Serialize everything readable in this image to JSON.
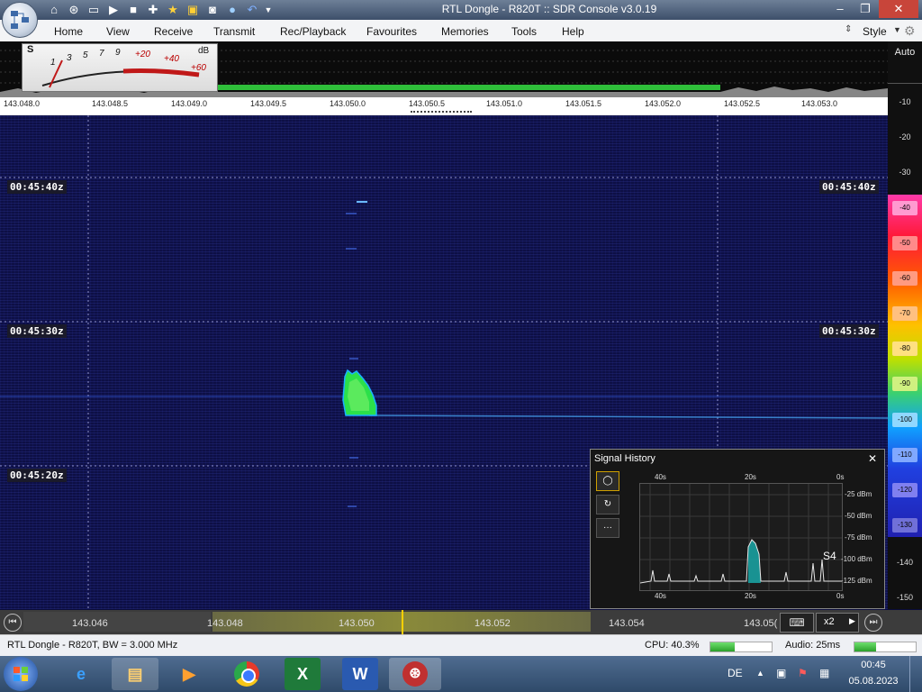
{
  "window": {
    "title": "RTL Dongle - R820T :: SDR Console v3.0.19"
  },
  "menu": {
    "items": [
      "Home",
      "View",
      "Receive",
      "Transmit",
      "Rec/Playback",
      "Favourites",
      "Memories",
      "Tools",
      "Help"
    ],
    "style_label": "Style"
  },
  "meter": {
    "s_label": "S",
    "db_label": "dB",
    "scale": [
      "1",
      "3",
      "5",
      "7",
      "9",
      "+20",
      "+40",
      "+60"
    ]
  },
  "spectrum": {
    "freq_labels": [
      "143.048.0",
      "143.048.5",
      "143.049.0",
      "143.049.5",
      "143.050.0",
      "143.050.5",
      "143.051.0",
      "143.051.5",
      "143.052.0",
      "143.052.5",
      "143.053.0"
    ]
  },
  "scale": {
    "auto_label": "Auto",
    "db_values": [
      "-10",
      "-20",
      "-30",
      "-40",
      "-50",
      "-60",
      "-70",
      "-80",
      "-90",
      "-100",
      "-110",
      "-120",
      "-130",
      "-140",
      "-150"
    ],
    "colors": [
      "#ff3aa8",
      "#ff2a2a",
      "#ff3010",
      "#ff6a00",
      "#ffb000",
      "#d6e000",
      "#7be000",
      "#22d3a0",
      "#1090ff",
      "#2050e0",
      "#2a2ad0"
    ]
  },
  "waterfall": {
    "timestamps": [
      "00:45:40z",
      "00:45:30z",
      "00:45:20z"
    ]
  },
  "signal_history": {
    "title": "Signal History",
    "close": "✕",
    "top_ticks": [
      "40s",
      "20s",
      "0s"
    ],
    "bottom_ticks": [
      "40s",
      "20s",
      "0s"
    ],
    "db_ticks": [
      "-25 dBm",
      "-50 dBm",
      "-75 dBm",
      "-100 dBm",
      "-125 dBm"
    ],
    "s_label": "S4"
  },
  "bottom_bar": {
    "freq_labels": [
      "143.046",
      "143.048",
      "143.050",
      "143.052",
      "143.054",
      "143.05("
    ],
    "zoom": "x2"
  },
  "status": {
    "device": "RTL Dongle - R820T, BW = 3.000 MHz",
    "cpu": "CPU: 40.3%",
    "cpu_level": 0.4,
    "audio": "Audio: 25ms",
    "audio_level": 0.35
  },
  "taskbar": {
    "language": "DE",
    "time": "00:45",
    "date": "05.08.2023"
  }
}
